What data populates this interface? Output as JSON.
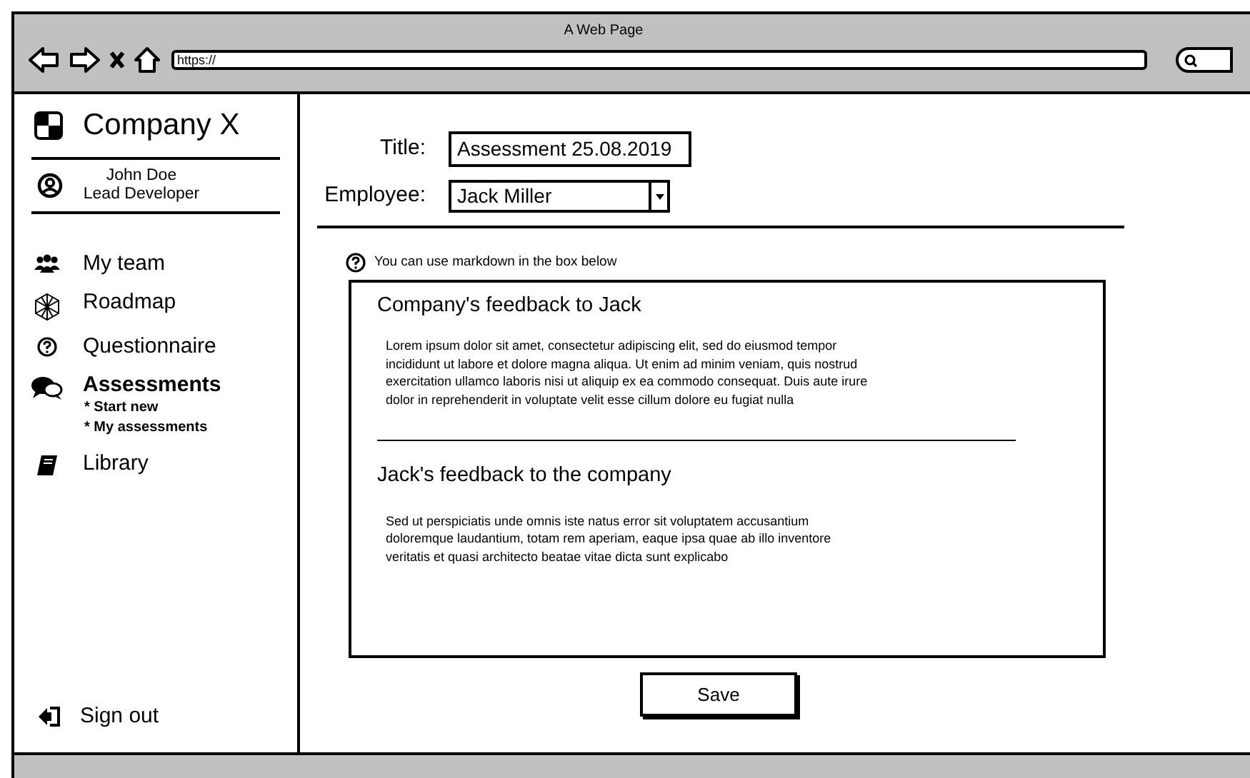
{
  "window": {
    "title": "A Web Page",
    "address": "https://"
  },
  "sidebar": {
    "brand": "Company X",
    "user": {
      "name": "John Doe",
      "role": "Lead Developer"
    },
    "items": [
      {
        "label": "My team",
        "selected": false
      },
      {
        "label": "Roadmap",
        "selected": false
      },
      {
        "label": "Questionnaire",
        "selected": false
      },
      {
        "label": "Assessments",
        "selected": true,
        "children": [
          {
            "label": "* Start new"
          },
          {
            "label": "* My assessments"
          }
        ]
      },
      {
        "label": "Library",
        "selected": false
      }
    ],
    "sign_out": "Sign out"
  },
  "form": {
    "title_label": "Title:",
    "title_value": "Assessment 25.08.2019",
    "employee_label": "Employee:",
    "employee_value": "Jack Miller"
  },
  "hint": "You can use markdown in the box below",
  "editor": {
    "sections": [
      {
        "heading": "Company's feedback to Jack",
        "text": "Lorem ipsum dolor sit amet, consectetur adipiscing elit, sed do eiusmod tempor incididunt ut labore et dolore magna aliqua. Ut enim ad minim veniam, quis nostrud exercitation ullamco laboris nisi ut aliquip ex ea commodo consequat. Duis aute irure dolor in reprehenderit in voluptate velit esse cillum dolore eu fugiat nulla"
      },
      {
        "heading": "Jack's feedback to the company",
        "text": "Sed ut perspiciatis unde omnis iste natus error sit voluptatem accusantium doloremque laudantium, totam rem aperiam, eaque ipsa quae ab illo inventore veritatis et quasi architecto beatae vitae dicta sunt explicabo"
      }
    ]
  },
  "save_button": "Save"
}
